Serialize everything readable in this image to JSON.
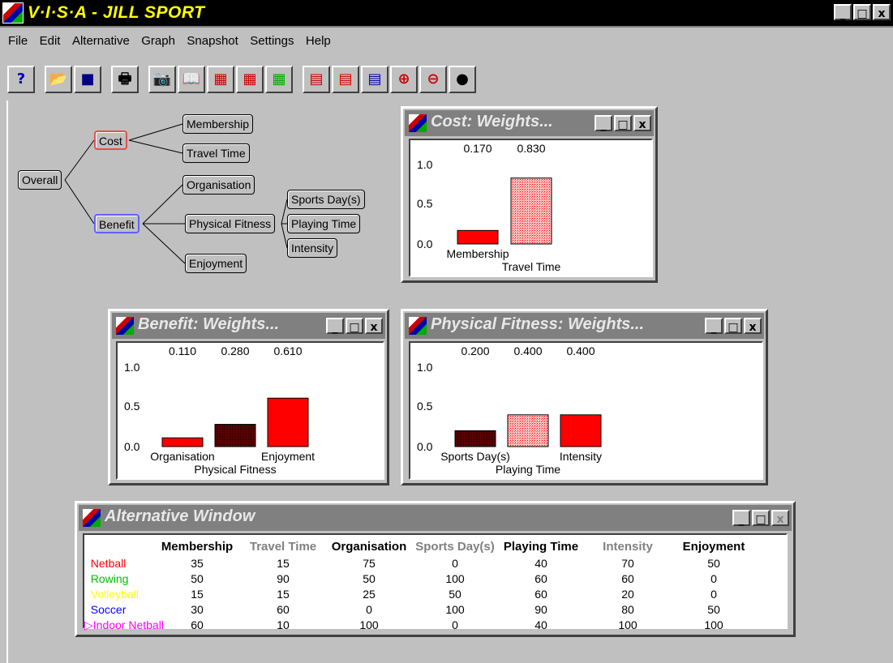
{
  "app": {
    "title": "V·I·S·A - JILL SPORT",
    "win_buttons": [
      "_",
      "□",
      "x"
    ]
  },
  "menu": [
    "File",
    "Edit",
    "Alternative",
    "Graph",
    "Snapshot",
    "Settings",
    "Help"
  ],
  "toolbar": [
    "help-icon",
    "open-folder-icon",
    "save-disk-icon",
    "print-icon",
    "camera-icon",
    "album-icon",
    "graph-1-icon",
    "graph-2-icon",
    "graph-3-icon",
    "chart-a-icon",
    "chart-b-icon",
    "chart-c-icon",
    "zoom-in-icon",
    "zoom-out-icon",
    "bomb-icon"
  ],
  "toolbar_glyphs": [
    "?",
    "📂",
    "■",
    "🖶",
    "📷",
    "📖",
    "▦",
    "▦",
    "▦",
    "▤",
    "▤",
    "▤",
    "⊕",
    "⊖",
    "●"
  ],
  "tree": {
    "overall": "Overall",
    "cost": "Cost",
    "benefit": "Benefit",
    "membership": "Membership",
    "travel_time": "Travel Time",
    "organisation": "Organisation",
    "physical_fitness": "Physical Fitness",
    "enjoyment": "Enjoyment",
    "sports_days": "Sports Day(s)",
    "playing_time": "Playing Time",
    "intensity": "Intensity"
  },
  "cost_window": {
    "title": "Cost: Weights...",
    "chart_data": {
      "type": "bar",
      "categories": [
        "Membership",
        "Travel Time"
      ],
      "values": [
        0.17,
        0.83
      ],
      "value_labels": [
        "0.170",
        "0.830"
      ],
      "yticks": [
        "1.0",
        "0.5",
        "0.0"
      ],
      "ylim": [
        0,
        1
      ],
      "colors": [
        "#ff0000",
        "pattern-light-red"
      ]
    }
  },
  "benefit_window": {
    "title": "Benefit: Weights...",
    "chart_data": {
      "type": "bar",
      "categories": [
        "Organisation",
        "Physical Fitness",
        "Enjoyment"
      ],
      "values": [
        0.11,
        0.28,
        0.61
      ],
      "value_labels": [
        "0.110",
        "0.280",
        "0.610"
      ],
      "yticks": [
        "1.0",
        "0.5",
        "0.0"
      ],
      "ylim": [
        0,
        1
      ],
      "colors": [
        "#ff0000",
        "pattern-dark-red",
        "#ff0000"
      ]
    }
  },
  "fitness_window": {
    "title": "Physical Fitness: Weights...",
    "chart_data": {
      "type": "bar",
      "categories": [
        "Sports Day(s)",
        "Playing Time",
        "Intensity"
      ],
      "values": [
        0.2,
        0.4,
        0.4
      ],
      "value_labels": [
        "0.200",
        "0.400",
        "0.400"
      ],
      "yticks": [
        "1.0",
        "0.5",
        "0.0"
      ],
      "ylim": [
        0,
        1
      ],
      "colors": [
        "pattern-dark-red",
        "pattern-light-red",
        "#ff0000"
      ]
    }
  },
  "alt_window": {
    "title": "Alternative Window",
    "columns": [
      {
        "label": "Membership",
        "color": "#000000"
      },
      {
        "label": "Travel Time",
        "color": "#808080"
      },
      {
        "label": "Organisation",
        "color": "#000000"
      },
      {
        "label": "Sports Day(s)",
        "color": "#808080"
      },
      {
        "label": "Playing Time",
        "color": "#000000"
      },
      {
        "label": "Intensity",
        "color": "#808080"
      },
      {
        "label": "Enjoyment",
        "color": "#000000"
      }
    ],
    "rows": [
      {
        "name": "Netball",
        "color": "#ff0000",
        "values": [
          "35",
          "15",
          "75",
          "0",
          "40",
          "70",
          "50"
        ]
      },
      {
        "name": "Rowing",
        "color": "#00c000",
        "values": [
          "50",
          "90",
          "50",
          "100",
          "60",
          "60",
          "0"
        ]
      },
      {
        "name": "Volleyball",
        "color": "#ffff00",
        "values": [
          "15",
          "15",
          "25",
          "50",
          "60",
          "20",
          "0"
        ]
      },
      {
        "name": "Soccer",
        "color": "#0000ff",
        "values": [
          "30",
          "60",
          "0",
          "100",
          "90",
          "80",
          "50"
        ]
      },
      {
        "name": "Indoor Netball",
        "color": "#ff00ff",
        "values": [
          "60",
          "10",
          "100",
          "0",
          "40",
          "100",
          "100"
        ],
        "selected": true
      }
    ]
  }
}
